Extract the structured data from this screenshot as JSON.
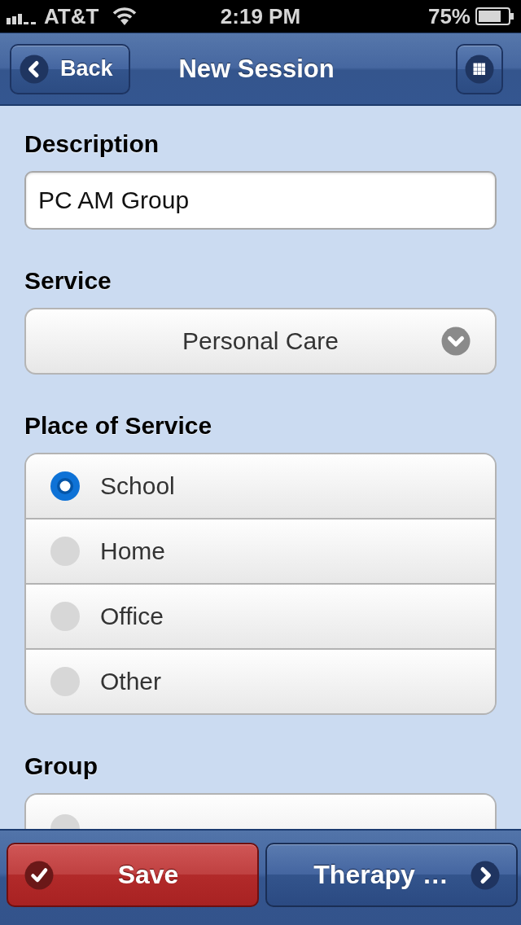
{
  "status_bar": {
    "carrier": "AT&T",
    "time": "2:19 PM",
    "battery": "75%"
  },
  "header": {
    "back": "Back",
    "title": "New Session"
  },
  "form": {
    "description": {
      "label": "Description",
      "value": "PC AM Group"
    },
    "service": {
      "label": "Service",
      "value": "Personal Care"
    },
    "place_of_service": {
      "label": "Place of Service",
      "options": [
        {
          "label": "School",
          "selected": true
        },
        {
          "label": "Home",
          "selected": false
        },
        {
          "label": "Office",
          "selected": false
        },
        {
          "label": "Other",
          "selected": false
        }
      ]
    },
    "group": {
      "label": "Group",
      "options": [
        {
          "selected": false
        }
      ]
    }
  },
  "footer": {
    "buttons": [
      {
        "kind": "save",
        "label": "Save"
      },
      {
        "kind": "forward",
        "label": "Therapy …"
      }
    ]
  }
}
